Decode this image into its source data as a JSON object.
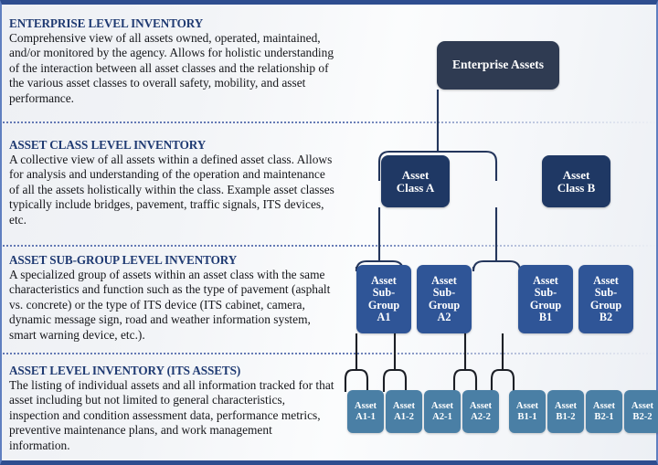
{
  "theme": {
    "accent_border": "#2e4d8f",
    "heading_color": "#1f3a72",
    "enterprise_box": "#2f3b52",
    "class_box": "#1f3864",
    "subgroup_box": "#2f5597",
    "asset_box": "#4a7fa5",
    "divider_color": "#4a63a8"
  },
  "sections": [
    {
      "title": "ENTERPRISE LEVEL INVENTORY",
      "body": "Comprehensive view of all assets owned, operated, maintained, and/or monitored by the agency. Allows for holistic understanding of the interaction between all asset classes and the relationship of the various asset classes to overall safety, mobility, and asset performance."
    },
    {
      "title": "ASSET CLASS LEVEL INVENTORY",
      "body": "A collective view of all assets within a defined asset class. Allows for analysis and understanding of the operation and maintenance of all the assets holistically within the class. Example asset classes typically include bridges, pavement, traffic signals, ITS devices, etc."
    },
    {
      "title": "ASSET SUB-GROUP LEVEL INVENTORY",
      "body": "A specialized group of assets within an asset class with the same characteristics and function such as the type of pavement (asphalt vs. concrete) or the type of ITS device (ITS cabinet, camera, dynamic message sign, road and weather information system, smart warning device, etc.)."
    },
    {
      "title": "ASSET LEVEL INVENTORY (ITS ASSETS)",
      "body": "The listing of individual assets and all information tracked for that asset including but not limited to general characteristics, inspection and condition assessment data, performance metrics, preventive maintenance plans, and work management information."
    }
  ],
  "diagram": {
    "enterprise": {
      "label": "Enterprise Assets"
    },
    "classes": [
      {
        "label": "Asset\nClass A"
      },
      {
        "label": "Asset\nClass B"
      }
    ],
    "subgroups": [
      {
        "label": "Asset\nSub-\nGroup\nA1"
      },
      {
        "label": "Asset\nSub-\nGroup\nA2"
      },
      {
        "label": "Asset\nSub-\nGroup\nB1"
      },
      {
        "label": "Asset\nSub-\nGroup\nB2"
      }
    ],
    "assets": [
      {
        "label": "Asset\nA1-1"
      },
      {
        "label": "Asset\nA1-2"
      },
      {
        "label": "Asset\nA2-1"
      },
      {
        "label": "Asset\nA2-2"
      },
      {
        "label": "Asset\nB1-1"
      },
      {
        "label": "Asset\nB1-2"
      },
      {
        "label": "Asset\nB2-1"
      },
      {
        "label": "Asset\nB2-2"
      }
    ]
  }
}
